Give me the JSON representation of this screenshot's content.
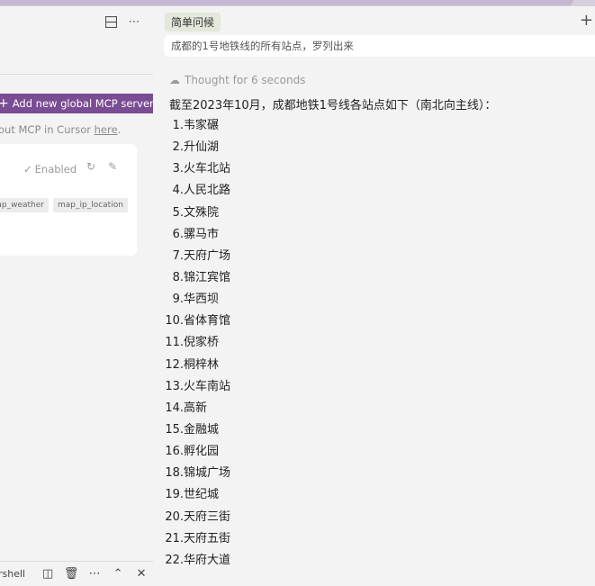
{
  "left_panel": {
    "add_button_label": "Add new global MCP server",
    "learn_text": "out MCP in Cursor ",
    "learn_link": "here",
    "learn_suffix": ".",
    "enabled_label": "Enabled",
    "tags": [
      "map_weather",
      "map_ip_location"
    ]
  },
  "bottom_bar": {
    "shell_label": "rshell"
  },
  "chat": {
    "title_chip": "简单问候",
    "prompt_text": "成都的1号地铁线的所有站点，罗列出来",
    "thought_label": "Thought for 6 seconds",
    "intro": "截至2023年10月，成都地铁1号线各站点如下（南北向主线）：",
    "stations": [
      {
        "n": "1.",
        "name": "韦家碾"
      },
      {
        "n": "2.",
        "name": "升仙湖"
      },
      {
        "n": "3.",
        "name": "火车北站"
      },
      {
        "n": "4.",
        "name": "人民北路"
      },
      {
        "n": "5.",
        "name": "文殊院"
      },
      {
        "n": "6.",
        "name": "骡马市"
      },
      {
        "n": "7.",
        "name": "天府广场"
      },
      {
        "n": "8.",
        "name": "锦江宾馆"
      },
      {
        "n": "9.",
        "name": "华西坝"
      },
      {
        "n": "10.",
        "name": "省体育馆"
      },
      {
        "n": "11.",
        "name": "倪家桥"
      },
      {
        "n": "12.",
        "name": "桐梓林"
      },
      {
        "n": "13.",
        "name": "火车南站"
      },
      {
        "n": "14.",
        "name": "高新"
      },
      {
        "n": "15.",
        "name": "金融城"
      },
      {
        "n": "16.",
        "name": "孵化园"
      },
      {
        "n": "18.",
        "name": "锦城广场"
      },
      {
        "n": "19.",
        "name": "世纪城"
      },
      {
        "n": "20.",
        "name": "天府三街"
      },
      {
        "n": "21.",
        "name": "天府五街"
      },
      {
        "n": "22.",
        "name": "华府大道"
      }
    ]
  },
  "colors": {
    "accent": "#7a4c93",
    "chip_bg": "#e2e8da"
  }
}
